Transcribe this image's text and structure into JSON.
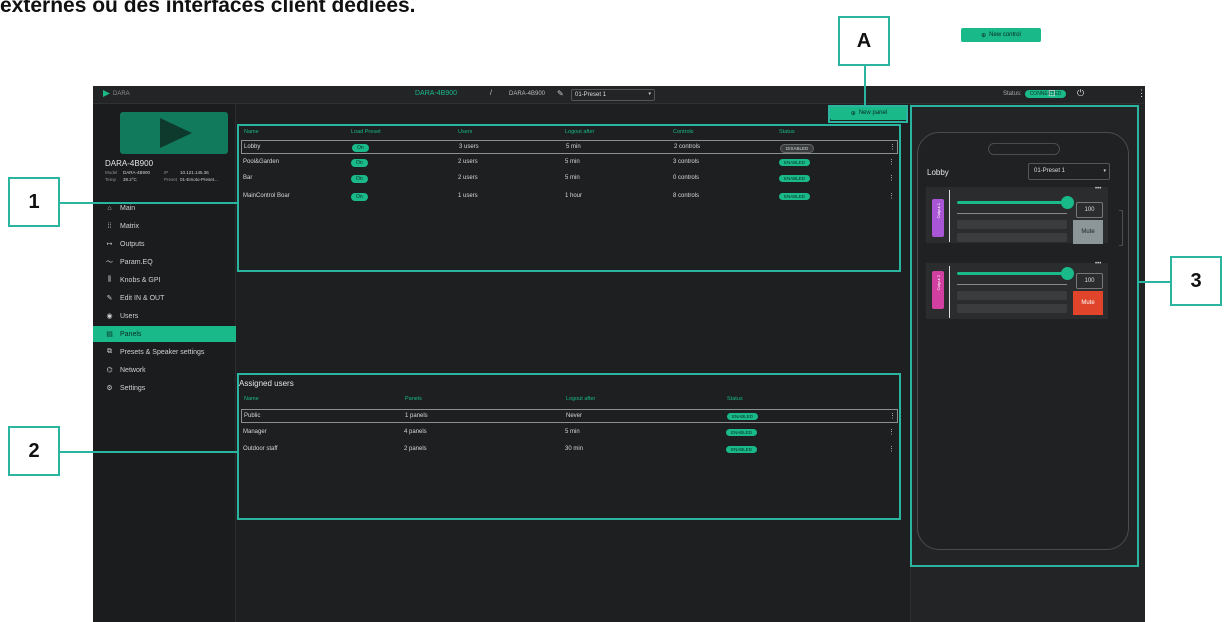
{
  "doc_heading": "externes ou des interfaces client dédiées.",
  "topbar": {
    "brand": "DARA",
    "device_link": "DARA-4B900",
    "separator": "/",
    "device_name": "DARA-4B900",
    "preset": "01-Preset 1",
    "status_label": "Status:",
    "status_value": "CONNECTED"
  },
  "sidebar": {
    "device_name": "DARA-4B900",
    "model_label": "Model",
    "model_value": "DARA-4B900",
    "ip_label": "IP",
    "ip_value": "10.121.145.36",
    "temp_label": "Temp",
    "temp_value": "38.2°C",
    "preset_label": "Preset",
    "preset_value": "01-Emoto-Preset...",
    "items": [
      {
        "label": "Main",
        "icon": "main-icon"
      },
      {
        "label": "Matrix",
        "icon": "grid-icon"
      },
      {
        "label": "Outputs",
        "icon": "output-arrow-icon"
      },
      {
        "label": "Param.EQ",
        "icon": "eq-curve-icon"
      },
      {
        "label": "Knobs & GPI",
        "icon": "knobs-icon"
      },
      {
        "label": "Edit IN & OUT",
        "icon": "pencil-icon"
      },
      {
        "label": "Users",
        "icon": "user-circle-icon"
      },
      {
        "label": "Panels",
        "icon": "panel-icon"
      },
      {
        "label": "Presets & Speaker settings",
        "icon": "preset-icon"
      },
      {
        "label": "Network",
        "icon": "network-icon"
      },
      {
        "label": "Settings",
        "icon": "gear-icon"
      }
    ]
  },
  "panels": {
    "new_button": "New panel",
    "headers": [
      "Name",
      "Load Preset",
      "Users",
      "Logout after",
      "Controls",
      "Status"
    ],
    "rows": [
      {
        "name": "Lobby",
        "load": "On",
        "users": "3 users",
        "logout": "5 min",
        "controls": "2 controls",
        "status": "DISABLED"
      },
      {
        "name": "Pool&Garden",
        "load": "On",
        "users": "2 users",
        "logout": "5 min",
        "controls": "3 controls",
        "status": "ENABLED"
      },
      {
        "name": "Bar",
        "load": "On",
        "users": "2 users",
        "logout": "5 min",
        "controls": "0 controls",
        "status": "ENABLED"
      },
      {
        "name": "MainControl Boar",
        "load": "On",
        "users": "1 users",
        "logout": "1 hour",
        "controls": "8 controls",
        "status": "ENABLED"
      }
    ]
  },
  "assigned": {
    "title": "Assigned users",
    "headers": [
      "Name",
      "Panels",
      "Logout after",
      "Status"
    ],
    "rows": [
      {
        "name": "Public",
        "panels": "1 panels",
        "logout": "Never",
        "status": "ENABLED"
      },
      {
        "name": "Manager",
        "panels": "4 panels",
        "logout": "5 min",
        "status": "ENABLED"
      },
      {
        "name": "Outdoor staff",
        "panels": "2 panels",
        "logout": "30 min",
        "status": "ENABLED"
      }
    ]
  },
  "preview": {
    "new_control_button": "New control",
    "panel_name": "Lobby",
    "preset": "01-Preset 1",
    "controls": [
      {
        "tab_label": "Output 1",
        "color": "#a855d6",
        "value": "100",
        "mute": "Mute",
        "muted": false
      },
      {
        "tab_label": "Output 2",
        "color": "#d13fa0",
        "value": "100",
        "mute": "Mute",
        "muted": true
      }
    ]
  },
  "annotations": {
    "A": "A",
    "one": "1",
    "two": "2",
    "three": "3"
  },
  "colors": {
    "accent": "#19b98a",
    "annotation": "#2bb5a0",
    "mute_active": "#e0442a"
  }
}
